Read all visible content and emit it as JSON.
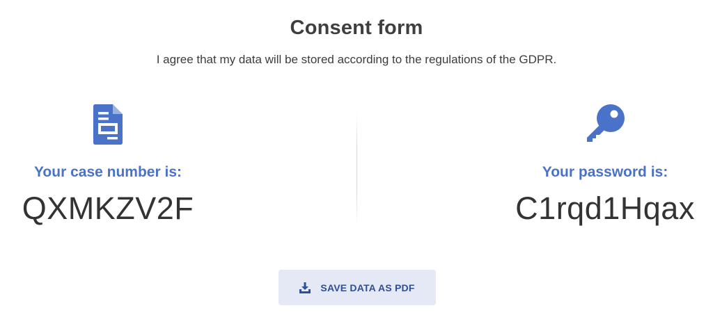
{
  "title": "Consent form",
  "subtitle": "I agree that my data will be stored according to the regulations of the GDPR.",
  "case": {
    "icon": "document-icon",
    "label": "Your case number is:",
    "value": "QXMKZV2F"
  },
  "password": {
    "icon": "key-icon",
    "label": "Your password is:",
    "value": "C1rqd1Hqax"
  },
  "save_button": {
    "icon": "download-icon",
    "label": "SAVE DATA AS PDF"
  },
  "colors": {
    "accent": "#4a72c8",
    "button_bg": "#e4e9f5",
    "button_text": "#2f4f94"
  }
}
